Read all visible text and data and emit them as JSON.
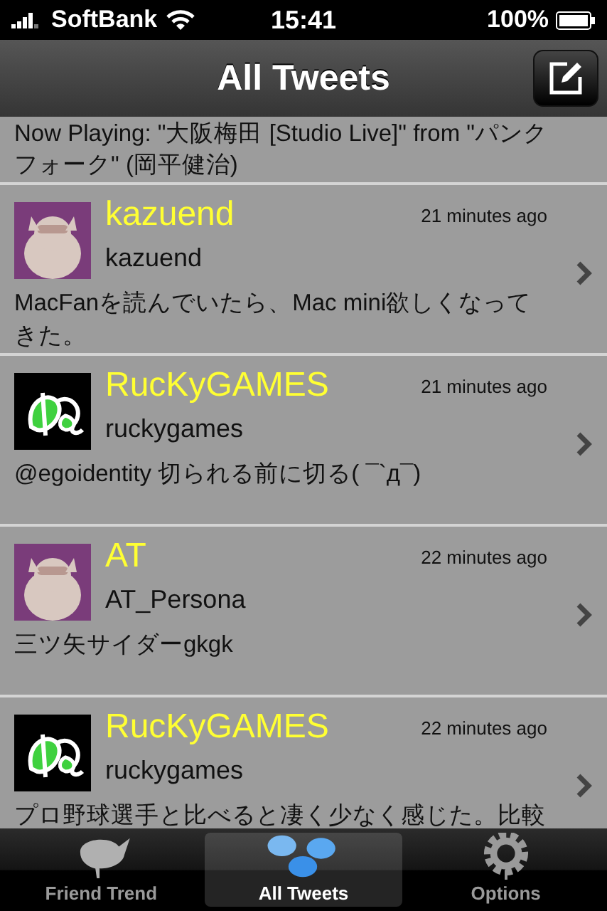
{
  "status_bar": {
    "carrier": "SoftBank",
    "time": "15:41",
    "battery": "100%"
  },
  "nav_bar": {
    "title": "All Tweets"
  },
  "tweets": [
    {
      "kind": "partial",
      "text": "Now Playing: \"大阪梅田 [Studio Live]\" from \"パンクフォーク\" (岡平健治)"
    },
    {
      "kind": "picture",
      "name": "kazuend",
      "time": "21 minutes ago",
      "handle": "kazuend",
      "text": "MacFanを読んでいたら、Mac mini欲しくなってきた。"
    },
    {
      "kind": "logo",
      "name": "RucKyGAMES",
      "time": "21 minutes ago",
      "handle": "ruckygames",
      "text": "@egoidentity 切られる前に切る( ¯`д¯)"
    },
    {
      "kind": "picture",
      "name": "AT",
      "time": "22 minutes ago",
      "handle": "AT_Persona",
      "text": "三ツ矢サイダーgkgk"
    },
    {
      "kind": "logo",
      "name": "RucKyGAMES",
      "time": "22 minutes ago",
      "handle": "ruckygames",
      "text": "プロ野球選手と比べると凄く少なく感じた。比較"
    }
  ],
  "tab_bar": [
    {
      "label": "Friend Trend",
      "selected": false
    },
    {
      "label": "All Tweets",
      "selected": true
    },
    {
      "label": "Options",
      "selected": false
    }
  ]
}
